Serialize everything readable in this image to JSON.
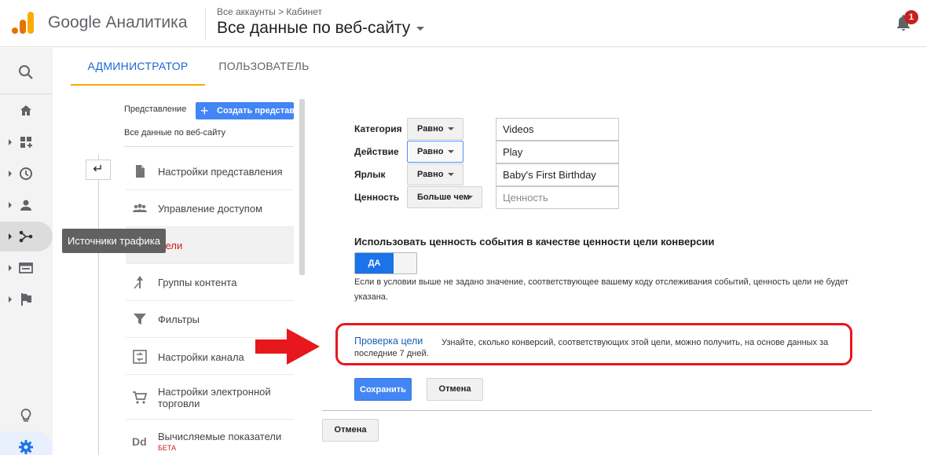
{
  "header": {
    "product_name": "Google Аналитика",
    "breadcrumb": "Все аккаунты > Кабинет",
    "view_name": "Все данные по веб-сайту",
    "notification_count": "1"
  },
  "colors": {
    "accent": "#1967d2",
    "brand_orange": "#f9ab00",
    "highlight_red": "#e8161d",
    "primary_button": "#4285f4"
  },
  "tooltip": {
    "text": "Источники трафика"
  },
  "tabs": [
    {
      "label": "АДМИНИСТРАТОР",
      "active": true
    },
    {
      "label": "ПОЛЬЗОВАТЕЛЬ",
      "active": false
    }
  ],
  "view_panel": {
    "label": "Представление",
    "create_button": "Создать представл",
    "selected_view": "Все данные по веб-сайту"
  },
  "menu": {
    "items": [
      {
        "label": "Настройки представления",
        "icon": "document-icon"
      },
      {
        "label": "Управление доступом",
        "icon": "people-icon"
      },
      {
        "label": "Цели",
        "icon": "flag-icon",
        "active": true
      },
      {
        "label": "Группы контента",
        "icon": "content-groups-icon"
      },
      {
        "label": "Фильтры",
        "icon": "filter-icon"
      },
      {
        "label": "Настройки канала",
        "icon": "channel-settings-icon"
      },
      {
        "label": "Настройки электронной торговли",
        "icon": "cart-icon"
      },
      {
        "label": "Вычисляемые показатели",
        "badge": "БЕТА",
        "icon": "dd-icon"
      }
    ]
  },
  "conditions": [
    {
      "label": "Категория",
      "operator": "Равно",
      "value": "Videos",
      "placeholder": ""
    },
    {
      "label": "Действие",
      "operator": "Равно",
      "value": "Play",
      "placeholder": ""
    },
    {
      "label": "Ярлык",
      "operator": "Равно",
      "value": "Baby's First Birthday",
      "placeholder": ""
    },
    {
      "label": "Ценность",
      "operator": "Больше чем",
      "value": "",
      "placeholder": "Ценность"
    }
  ],
  "event_value": {
    "title": "Использовать ценность события в качестве ценности цели конверсии",
    "toggle_label": "ДА",
    "note": "Если в условии выше не задано значение, соответствующее вашему коду отслеживания событий, ценность цели не будет указана."
  },
  "verification": {
    "link": "Проверка цели",
    "description": "Узнайте, сколько конверсий, соответствующих этой цели, можно получить, на основе данных за последние 7 дней."
  },
  "buttons": {
    "save": "Сохранить",
    "cancel": "Отмена",
    "cancel_bottom": "Отмена"
  }
}
